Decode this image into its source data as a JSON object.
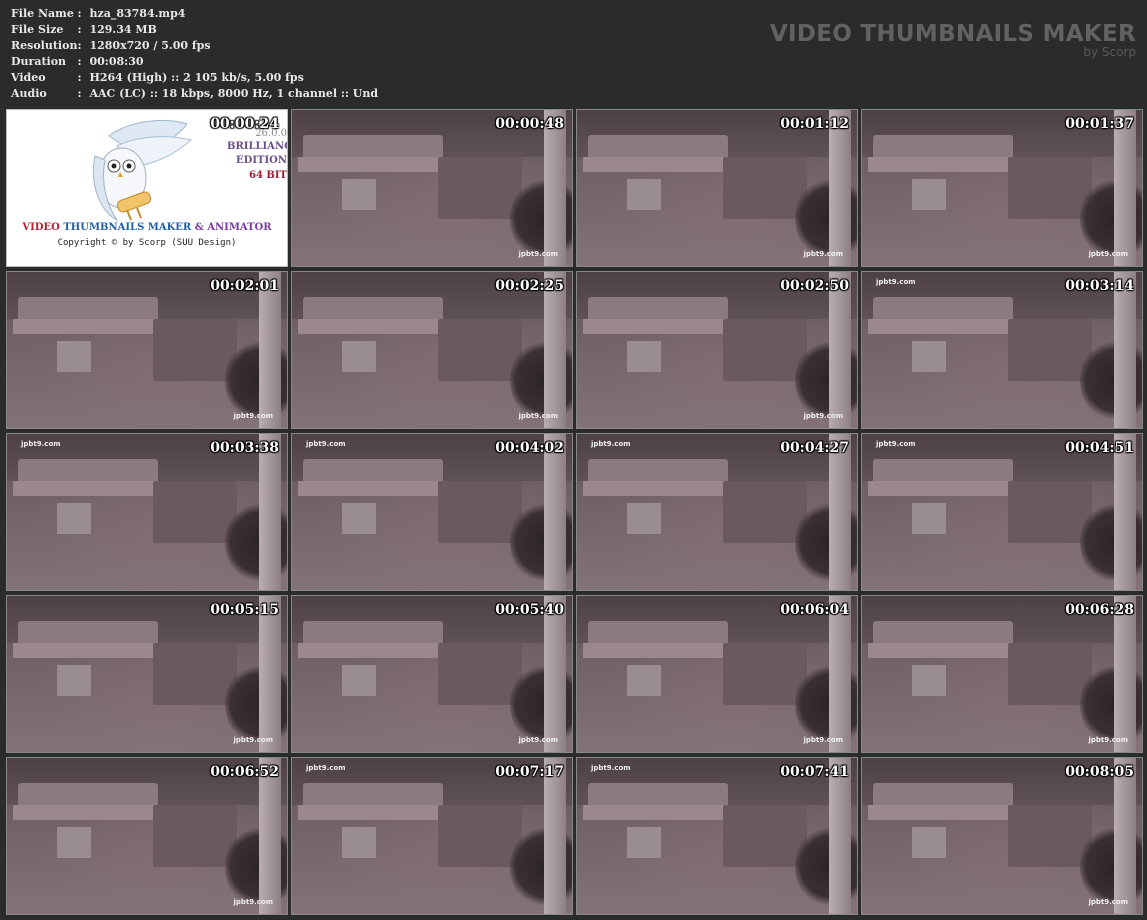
{
  "info": [
    {
      "key": "File Name",
      "value": "hza_83784.mp4"
    },
    {
      "key": "File Size",
      "value": "129.34 MB"
    },
    {
      "key": "Resolution",
      "value": "1280x720 / 5.00 fps"
    },
    {
      "key": "Duration",
      "value": "00:08:30"
    },
    {
      "key": "Video",
      "value": "H264 (High) :: 2 105 kb/s, 5.00 fps"
    },
    {
      "key": "Audio",
      "value": "AAC (LC) :: 18 kbps, 8000 Hz, 1 channel :: Und"
    }
  ],
  "separator": ":",
  "brand": {
    "title": "VIDEO THUMBNAILS MAKER",
    "subtitle": "by Scorp"
  },
  "logo": {
    "timestamp": "00:00:24",
    "version": "26.0.0",
    "edition_line1": "BRILLIANCE",
    "edition_line2": "EDITION",
    "edition_line3": "64 BIT",
    "product_part1": "VIDEO",
    "product_part2": "THUMBNAILS MAKER",
    "product_part3": "& ANIMATOR",
    "copyright": "Copyright © by Scorp (SUU Design)"
  },
  "watermark": "jpbt9.com",
  "thumbnails": [
    {
      "time": "00:00:48",
      "wm": "br"
    },
    {
      "time": "00:01:12",
      "wm": "br"
    },
    {
      "time": "00:01:37",
      "wm": "br"
    },
    {
      "time": "00:02:01",
      "wm": "br"
    },
    {
      "time": "00:02:25",
      "wm": "br"
    },
    {
      "time": "00:02:50",
      "wm": "br"
    },
    {
      "time": "00:03:14",
      "wm": "tl"
    },
    {
      "time": "00:03:38",
      "wm": "tl"
    },
    {
      "time": "00:04:02",
      "wm": "tl"
    },
    {
      "time": "00:04:27",
      "wm": "tl"
    },
    {
      "time": "00:04:51",
      "wm": "tl"
    },
    {
      "time": "00:05:15",
      "wm": "br"
    },
    {
      "time": "00:05:40",
      "wm": "br"
    },
    {
      "time": "00:06:04",
      "wm": "br"
    },
    {
      "time": "00:06:28",
      "wm": "br"
    },
    {
      "time": "00:06:52",
      "wm": "br"
    },
    {
      "time": "00:07:17",
      "wm": "tl"
    },
    {
      "time": "00:07:41",
      "wm": "tl"
    },
    {
      "time": "00:08:05",
      "wm": "br"
    }
  ],
  "colors": {
    "background": "#2b2b2b",
    "text": "#e8e8e8",
    "brand": "#626262"
  }
}
